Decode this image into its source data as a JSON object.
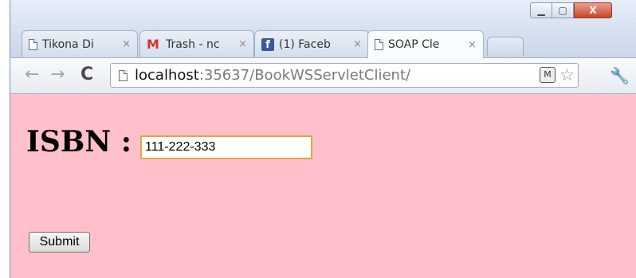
{
  "window_controls": {
    "minimize": "▁",
    "maximize": "▢",
    "close": "X"
  },
  "tabs": [
    {
      "title": "Tikona Di",
      "icon": "page-icon",
      "close": "×"
    },
    {
      "title": "Trash - nc",
      "icon": "gmail-icon",
      "close": "×"
    },
    {
      "title": "(1) Faceb",
      "icon": "facebook-icon",
      "close": "×"
    },
    {
      "title": "SOAP Cle",
      "icon": "page-icon",
      "close": "×",
      "active": true
    }
  ],
  "toolbar": {
    "back": "←",
    "forward": "→",
    "reload": "C",
    "url_host": "localhost",
    "url_rest": ":35637/BookWSServletClient/"
  },
  "form": {
    "isbn_label": "ISBN :",
    "isbn_value": "111-222-333",
    "submit_label": "Submit"
  },
  "colors": {
    "content_bg": "#ffc0cb",
    "input_focus": "#e3a83a"
  }
}
